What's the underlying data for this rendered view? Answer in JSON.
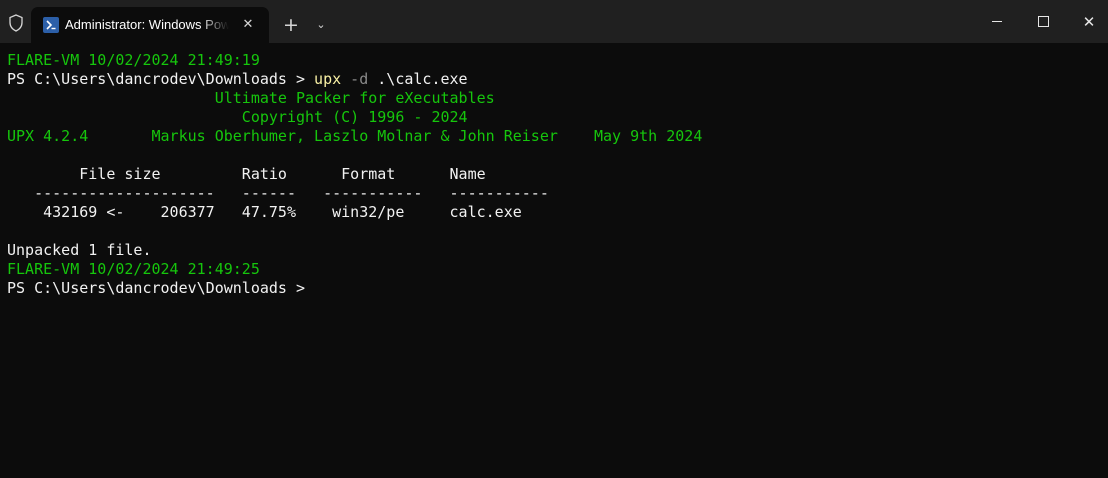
{
  "window": {
    "tab_title": "Administrator: Windows PowerShell",
    "tab_close": "✕",
    "new_tab": "+",
    "dropdown": "⌄",
    "close_glyph": "✕"
  },
  "colors": {
    "background": "#0c0c0c",
    "titlebar": "#202020",
    "green": "#16c60c",
    "yellow": "#f9f1a5",
    "text": "#cccccc"
  },
  "terminal": {
    "prompt_header_1": "FLARE-VM 10/02/2024 21:49:19",
    "prompt_1": "PS C:\\Users\\dancrodev\\Downloads > ",
    "cmd_name": "upx",
    "cmd_flag": "-d",
    "cmd_arg": ".\\calc.exe",
    "banner_1": "                       Ultimate Packer for eXecutables",
    "banner_2": "                          Copyright (C) 1996 - 2024",
    "banner_3": "UPX 4.2.4       Markus Oberhumer, Laszlo Molnar & John Reiser    May 9th 2024",
    "table_header": "        File size         Ratio      Format      Name",
    "table_rule": "   --------------------   ------   -----------   -----------",
    "table_row": "    432169 <-    206377   47.75%    win32/pe     calc.exe",
    "result": "Unpacked 1 file.",
    "prompt_header_2": "FLARE-VM 10/02/2024 21:49:25",
    "prompt_2": "PS C:\\Users\\dancrodev\\Downloads > "
  }
}
